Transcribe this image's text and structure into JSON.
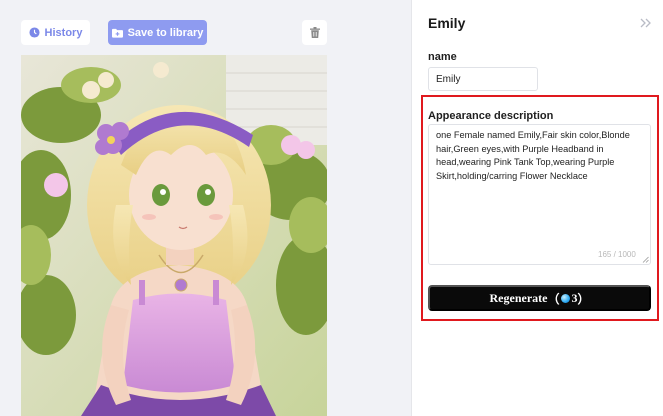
{
  "toolbar": {
    "history_label": "History",
    "save_label": "Save to library"
  },
  "character": {
    "title": "Emily",
    "name_label": "name",
    "name_value": "Emily",
    "appearance_label": "Appearance description",
    "appearance_text": "one Female named Emily,Fair skin color,Blonde hair,Green eyes,with Purple Headband in head,wearing Pink Tank Top,wearing Purple Skirt,holding/carring Flower Necklace",
    "char_counter": "165 / 1000",
    "regenerate_label": "Regenerate",
    "regenerate_open": "（",
    "regenerate_cost": "3",
    "regenerate_close": "）"
  },
  "colors": {
    "accent": "#8e9bf0",
    "highlight_border": "#e0191e",
    "primary_button": "#0a0a0a"
  },
  "icons": [
    "history-icon",
    "folder-save-icon",
    "trash-icon",
    "collapse-chevrons-icon",
    "gem-icon"
  ]
}
